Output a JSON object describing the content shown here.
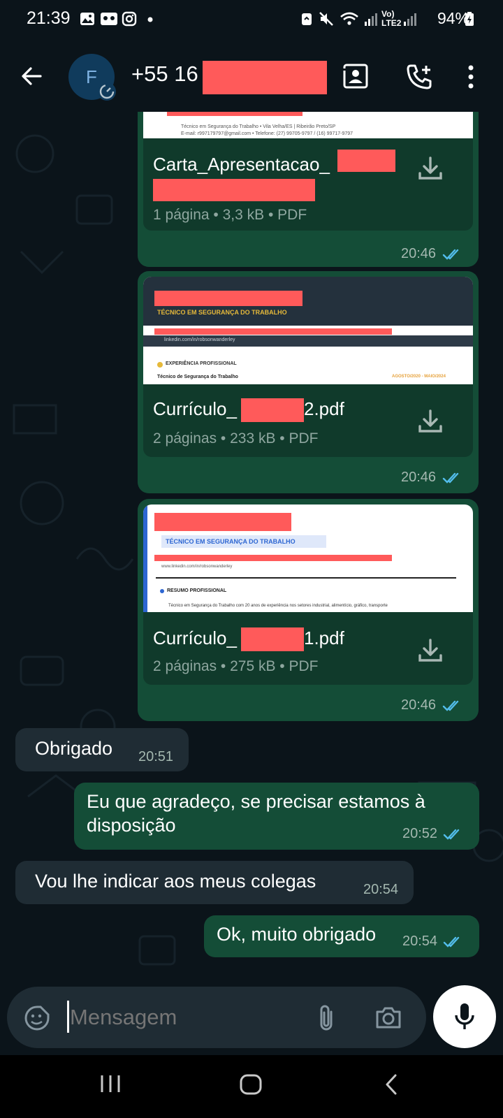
{
  "status_bar": {
    "time": "21:39",
    "battery": "94%"
  },
  "header": {
    "avatar_letter": "F",
    "contact_prefix": "+55 16"
  },
  "messages": [
    {
      "type": "document",
      "direction": "out",
      "name_visible_lines": [
        "Carta_Apresentacao_"
      ],
      "meta": "1 página • 3,3 kB • PDF",
      "time": "20:46",
      "thumb_lines": [
        "Técnico em Segurança do Trabalho • Vila Velha/ES | Ribeirão Preto/SP",
        "E-mail: r997179797@gmail.com • Telefone: (27) 99705-9797 / (16) 99717-9797"
      ]
    },
    {
      "type": "document",
      "direction": "out",
      "name_prefix": "Currículo_",
      "name_suffix": " 2.pdf",
      "meta": "2 páginas • 233 kB • PDF",
      "time": "20:46",
      "thumb_title": "TÉCNICO EM SEGURANÇA DO TRABALHO",
      "thumb_link": "linkedin.com/in/robsonwanderley",
      "thumb_section": "EXPERIÊNCIA PROFISSIONAL",
      "thumb_job": "Técnico de Segurança do Trabalho",
      "thumb_dates": "AGOSTO/2020 - MAIO/2024"
    },
    {
      "type": "document",
      "direction": "out",
      "name_prefix": "Currículo_",
      "name_suffix": " 1.pdf",
      "meta": "2 páginas • 275 kB • PDF",
      "time": "20:46",
      "thumb_title": "TÉCNICO EM SEGURANÇA DO TRABALHO",
      "thumb_link": "www.linkedin.com/in/robsonwanderley",
      "thumb_section": "RESUMO PROFISSIONAL",
      "thumb_text": "Técnico em Segurança do Trabalho com 20 anos de experiência nos setores industrial, alimentício, gráfico, transporte"
    },
    {
      "type": "text",
      "direction": "in",
      "text": "Obrigado",
      "time": "20:51"
    },
    {
      "type": "text",
      "direction": "out",
      "text_line1": "Eu que agradeço, se precisar estamos à",
      "text_line2": "disposição",
      "time": "20:52"
    },
    {
      "type": "text",
      "direction": "in",
      "text": "Vou lhe indicar aos meus colegas",
      "time": "20:54"
    },
    {
      "type": "text",
      "direction": "out",
      "text": "Ok, muito obrigado",
      "time": "20:54"
    }
  ],
  "composer": {
    "placeholder": "Mensagem"
  },
  "colors": {
    "background": "#0b141a",
    "outgoing_bubble": "#144d37",
    "incoming_bubble": "#1f2c34",
    "read_ticks": "#53bdeb",
    "redaction": "#ff5a5a"
  }
}
